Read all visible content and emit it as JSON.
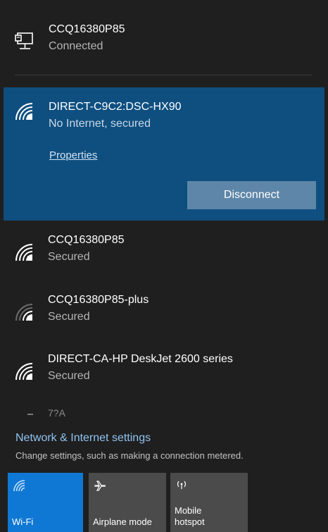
{
  "ethernet": {
    "name": "CCQ16380P85",
    "status": "Connected",
    "icon": "ethernet-icon"
  },
  "selected_network": {
    "name": "DIRECT-C9C2:DSC-HX90",
    "status": "No Internet, secured",
    "properties_label": "Properties",
    "disconnect_label": "Disconnect",
    "icon": "wifi-secured-icon"
  },
  "networks": [
    {
      "name": "CCQ16380P85",
      "status": "Secured",
      "icon": "wifi-secured-icon"
    },
    {
      "name": "CCQ16380P85-plus",
      "status": "Secured",
      "icon": "wifi-weak-secured-icon"
    },
    {
      "name": "DIRECT-CA-HP DeskJet 2600 series",
      "status": "Secured",
      "icon": "wifi-secured-icon"
    }
  ],
  "partial_network": {
    "name": "7?A"
  },
  "settings": {
    "link_label": "Network & Internet settings",
    "description": "Change settings, such as making a connection metered."
  },
  "tiles": {
    "wifi": {
      "label": "Wi-Fi",
      "icon": "wifi-icon"
    },
    "airplane": {
      "label": "Airplane mode",
      "icon": "airplane-icon"
    },
    "hotspot": {
      "label_line1": "Mobile",
      "label_line2": "hotspot",
      "icon": "hotspot-icon"
    }
  },
  "colors": {
    "panel_bg": "#1f1f1f",
    "selected_bg": "#0f4f80",
    "button_bg": "#5e86a8",
    "accent": "#0f78d4",
    "link": "#8fc3f0",
    "tile_inactive": "#4b4b4b"
  }
}
